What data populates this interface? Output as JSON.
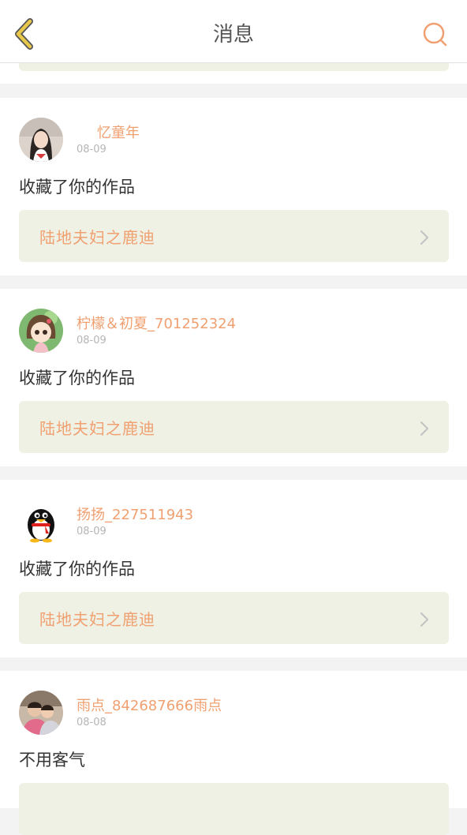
{
  "header": {
    "title": "消息",
    "back_icon": "chevron-left-icon",
    "search_icon": "search-icon",
    "accent_color": "#f0a070",
    "back_color": "#e8c84a"
  },
  "messages": [
    {
      "user": "忆童年",
      "date": "08-09",
      "text": "收藏了你的作品",
      "work_title": "陆地夫妇之鹿迪"
    },
    {
      "user": "柠檬＆初夏_701252324",
      "date": "08-09",
      "text": "收藏了你的作品",
      "work_title": "陆地夫妇之鹿迪"
    },
    {
      "user": "扬扬_227511943",
      "date": "08-09",
      "text": "收藏了你的作品",
      "work_title": "陆地夫妇之鹿迪"
    },
    {
      "user": "雨点_842687666雨点",
      "date": "08-08",
      "text": "不用客气",
      "work_title": ""
    }
  ],
  "colors": {
    "page_bg": "#f3f3f3",
    "card_bg": "#ffffff",
    "link_bg": "#eff1e5",
    "name_color": "#f0a070",
    "date_color": "#b5b5b5"
  }
}
